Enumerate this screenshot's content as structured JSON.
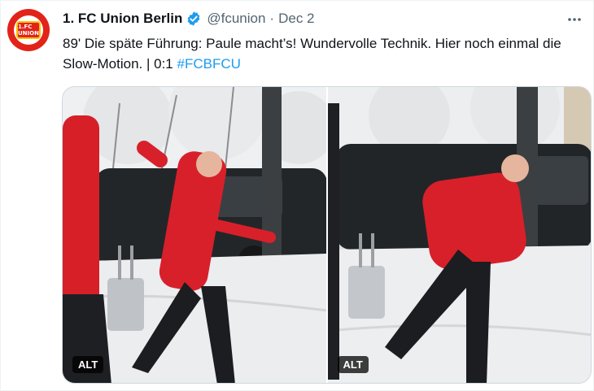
{
  "account": {
    "name": "1. FC Union Berlin",
    "handle": "@fcunion",
    "separator": "·",
    "date": "Dec 2",
    "avatar_text": "1.FC UNION"
  },
  "tweet": {
    "text": "89' Die späte Führung: Paule macht’s! Wundervolle Technik. Hier noch einmal die Slow-Motion. | 0:1",
    "hashtag": "#FCBFCU"
  },
  "media": {
    "photos": [
      {
        "alt_label": "ALT"
      },
      {
        "alt_label": "ALT"
      }
    ]
  },
  "more_icon": "more-horizontal-icon",
  "colors": {
    "accent": "#1d9bf0",
    "brand_red": "#e2231a",
    "text": "#0f1419",
    "secondary": "#536471"
  }
}
